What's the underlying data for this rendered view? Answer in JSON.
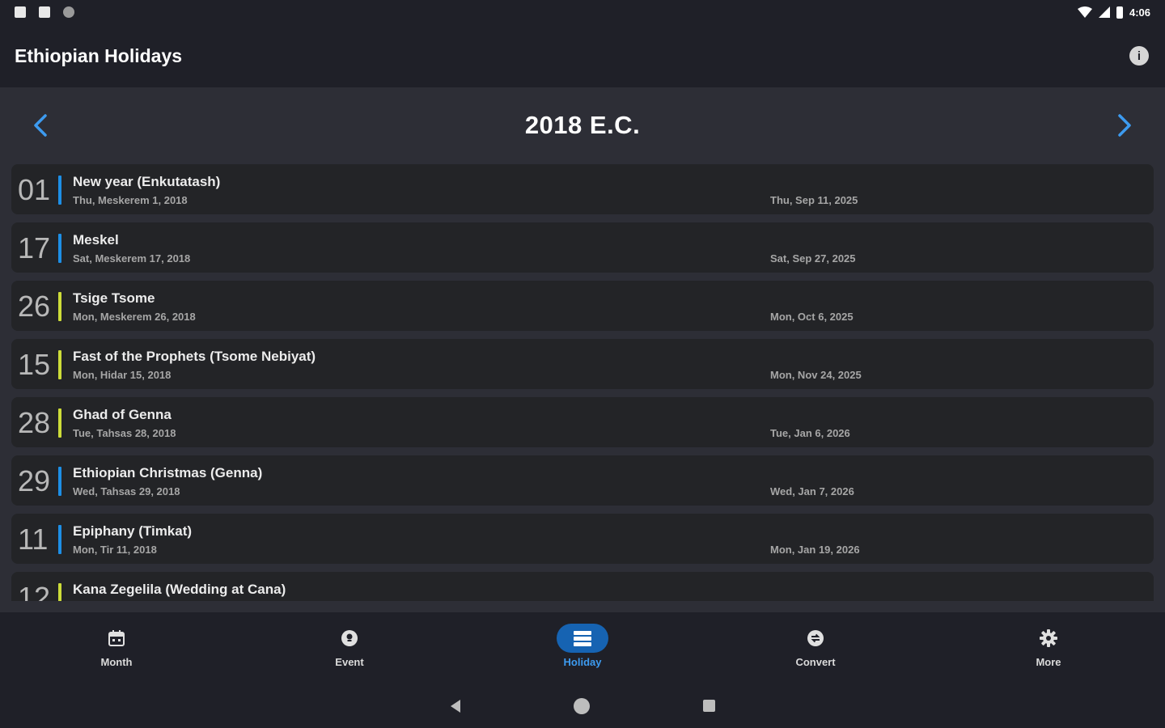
{
  "status_bar": {
    "time": "4:06",
    "icons": [
      "notification-icon",
      "sim-card-icon",
      "sync-icon",
      "wifi-icon",
      "signal-icon",
      "battery-icon"
    ]
  },
  "app_bar": {
    "title": "Ethiopian Holidays",
    "info_icon": "info-icon"
  },
  "year_header": {
    "title": "2018 E.C.",
    "prev_icon": "chevron-left-icon",
    "next_icon": "chevron-right-icon",
    "arrow_color": "#3d9bf0"
  },
  "holidays": [
    {
      "day": "01",
      "name": "New year (Enkutatash)",
      "eth_date": "Thu, Meskerem 1, 2018",
      "greg_date": "Thu, Sep 11, 2025",
      "color": "blue"
    },
    {
      "day": "17",
      "name": "Meskel",
      "eth_date": "Sat, Meskerem 17, 2018",
      "greg_date": "Sat, Sep 27, 2025",
      "color": "blue"
    },
    {
      "day": "26",
      "name": "Tsige Tsome",
      "eth_date": "Mon, Meskerem 26, 2018",
      "greg_date": "Mon, Oct 6, 2025",
      "color": "yellow"
    },
    {
      "day": "15",
      "name": "Fast of the Prophets (Tsome Nebiyat)",
      "eth_date": "Mon, Hidar 15, 2018",
      "greg_date": "Mon, Nov 24, 2025",
      "color": "yellow"
    },
    {
      "day": "28",
      "name": "Ghad of Genna",
      "eth_date": "Tue, Tahsas 28, 2018",
      "greg_date": "Tue, Jan 6, 2026",
      "color": "yellow"
    },
    {
      "day": "29",
      "name": "Ethiopian Christmas (Genna)",
      "eth_date": "Wed, Tahsas 29, 2018",
      "greg_date": "Wed, Jan 7, 2026",
      "color": "blue"
    },
    {
      "day": "11",
      "name": "Epiphany (Timkat)",
      "eth_date": "Mon, Tir 11, 2018",
      "greg_date": "Mon, Jan 19, 2026",
      "color": "blue"
    },
    {
      "day": "12",
      "name": "Kana Zegelila (Wedding at Cana)",
      "eth_date": "",
      "greg_date": "",
      "color": "yellow"
    }
  ],
  "bottom_nav": [
    {
      "label": "Month",
      "icon": "calendar-icon",
      "active": false
    },
    {
      "label": "Event",
      "icon": "event-icon",
      "active": false
    },
    {
      "label": "Holiday",
      "icon": "holiday-list-icon",
      "active": true
    },
    {
      "label": "Convert",
      "icon": "convert-icon",
      "active": false
    },
    {
      "label": "More",
      "icon": "settings-gear-icon",
      "active": false
    }
  ],
  "system_nav": {
    "icons": [
      "back-icon",
      "home-icon",
      "recents-icon"
    ]
  },
  "colors": {
    "accent": "#3d9bf0",
    "active_pill": "#1663b2",
    "bar_blue": "#1d8fe6",
    "bar_yellow": "#cddc39",
    "background": "#2d2e36",
    "card": "#232427"
  }
}
